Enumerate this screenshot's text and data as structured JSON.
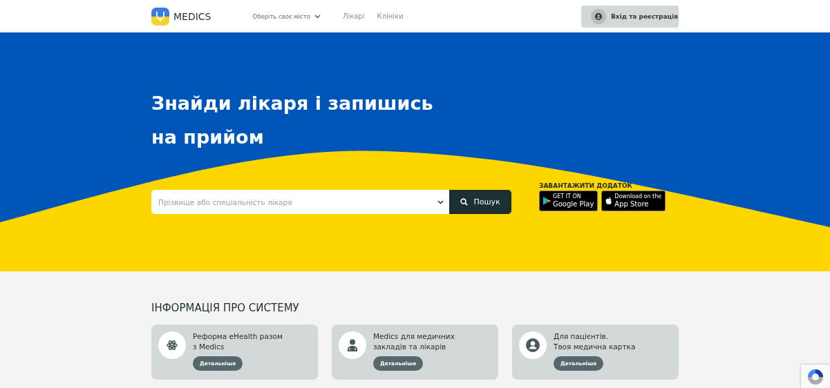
{
  "header": {
    "logo_text": "MEDICS",
    "city_select": "Оберіть своє місто",
    "nav": [
      "Лікарі",
      "Клініки"
    ],
    "login_button": "Вхід та реєстрація"
  },
  "hero": {
    "title": "Знайди лікаря і запишись на прийом",
    "search": {
      "placeholder": "Прізвище або спеціальність лікаря",
      "button": "Пошук"
    },
    "download": {
      "title": "ЗАВАНТАЖИТИ ДОДАТОК",
      "stores": [
        {
          "kind": "google",
          "small": "GET IT ON",
          "name": "Google Play"
        },
        {
          "kind": "apple",
          "small": "Download on the",
          "name": "App Store"
        }
      ]
    }
  },
  "info": {
    "title": "ІНФОРМАЦІЯ ПРО СИСТЕМУ",
    "cards": [
      {
        "kind": "atom",
        "lines": [
          "Реформа eHealth разом",
          "з Medics"
        ],
        "button": "Детальніше"
      },
      {
        "kind": "doctor",
        "lines": [
          "Medics для медичних",
          "закладів та лікарів"
        ],
        "button": "Детальніше"
      },
      {
        "kind": "user",
        "lines": [
          "Для пацієнтів.",
          "Твоя медична картка"
        ],
        "button": "Детальніше"
      }
    ]
  }
}
